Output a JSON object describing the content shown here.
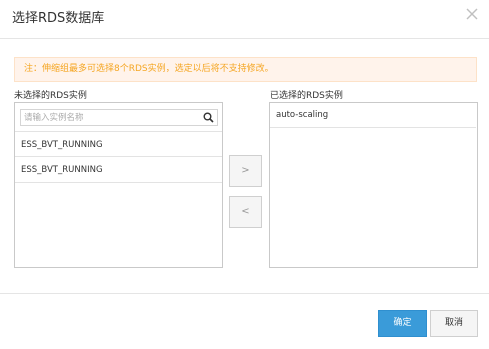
{
  "dialog": {
    "title": "选择RDS数据库",
    "close_icon": "close-icon"
  },
  "notice": {
    "text": "注：伸缩组最多可选择8个RDS实例，选定以后将不支持修改。"
  },
  "available": {
    "label": "未选择的RDS实例",
    "search_placeholder": "请输入实例名称",
    "search_icon": "search-icon",
    "items": [
      {
        "name": "ESS_BVT_RUNNING"
      },
      {
        "name": "ESS_BVT_RUNNING"
      }
    ]
  },
  "transfer": {
    "add_label": ">",
    "remove_label": "<"
  },
  "selected": {
    "label": "已选择的RDS实例",
    "items": [
      {
        "name": "auto-scaling"
      }
    ]
  },
  "footer": {
    "confirm_label": "确定",
    "cancel_label": "取消"
  },
  "colors": {
    "primary": "#3a9bd9",
    "notice_bg": "#fff3eb",
    "notice_text": "#f5a623"
  }
}
